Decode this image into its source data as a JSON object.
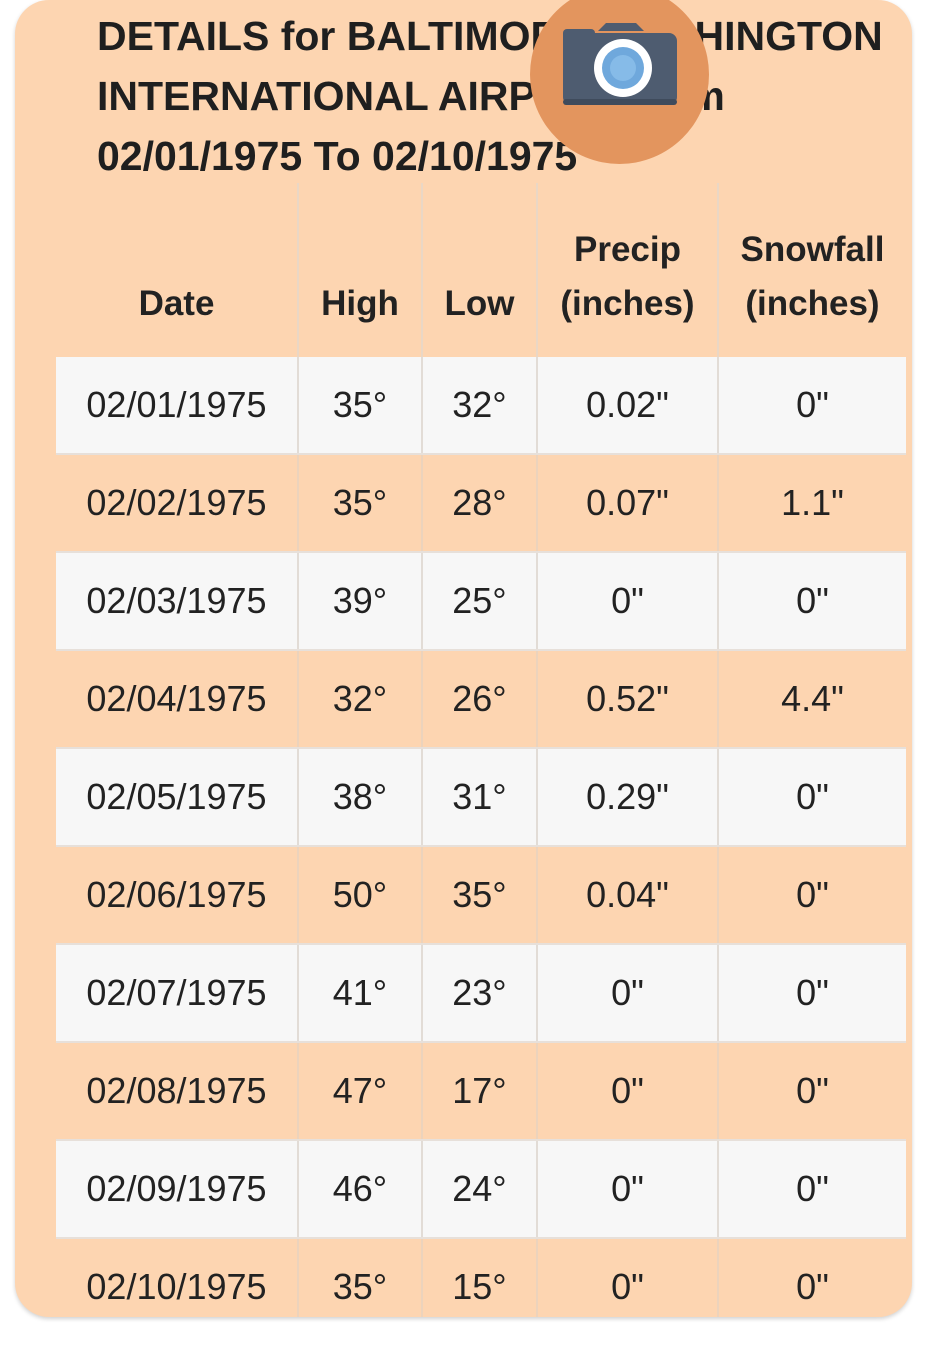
{
  "title": {
    "line1": "DETAILS for BALTIMORE-WASHINGTON",
    "line2": "INTERNATIONAL AIRPORT from",
    "line3": "02/01/1975 To 02/10/1975"
  },
  "screenshot_button": {
    "icon": "camera-icon",
    "color": "#e3955e"
  },
  "table": {
    "headers": {
      "date": "Date",
      "high": "High",
      "low": "Low",
      "precip_line1": "Precip",
      "precip_line2": "(inches)",
      "snow_line1": "Snowfall",
      "snow_line2": "(inches)"
    },
    "rows": [
      {
        "date": "02/01/1975",
        "high": "35°",
        "low": "32°",
        "precip": "0.02\"",
        "snow": "0\""
      },
      {
        "date": "02/02/1975",
        "high": "35°",
        "low": "28°",
        "precip": "0.07\"",
        "snow": "1.1\""
      },
      {
        "date": "02/03/1975",
        "high": "39°",
        "low": "25°",
        "precip": "0\"",
        "snow": "0\""
      },
      {
        "date": "02/04/1975",
        "high": "32°",
        "low": "26°",
        "precip": "0.52\"",
        "snow": "4.4\""
      },
      {
        "date": "02/05/1975",
        "high": "38°",
        "low": "31°",
        "precip": "0.29\"",
        "snow": "0\""
      },
      {
        "date": "02/06/1975",
        "high": "50°",
        "low": "35°",
        "precip": "0.04\"",
        "snow": "0\""
      },
      {
        "date": "02/07/1975",
        "high": "41°",
        "low": "23°",
        "precip": "0\"",
        "snow": "0\""
      },
      {
        "date": "02/08/1975",
        "high": "47°",
        "low": "17°",
        "precip": "0\"",
        "snow": "0\""
      },
      {
        "date": "02/09/1975",
        "high": "46°",
        "low": "24°",
        "precip": "0\"",
        "snow": "0\""
      },
      {
        "date": "02/10/1975",
        "high": "35°",
        "low": "15°",
        "precip": "0\"",
        "snow": "0\""
      }
    ]
  },
  "colors": {
    "card_background": "#fdd5b1",
    "row_light": "#f7f7f7",
    "text": "#222222"
  }
}
